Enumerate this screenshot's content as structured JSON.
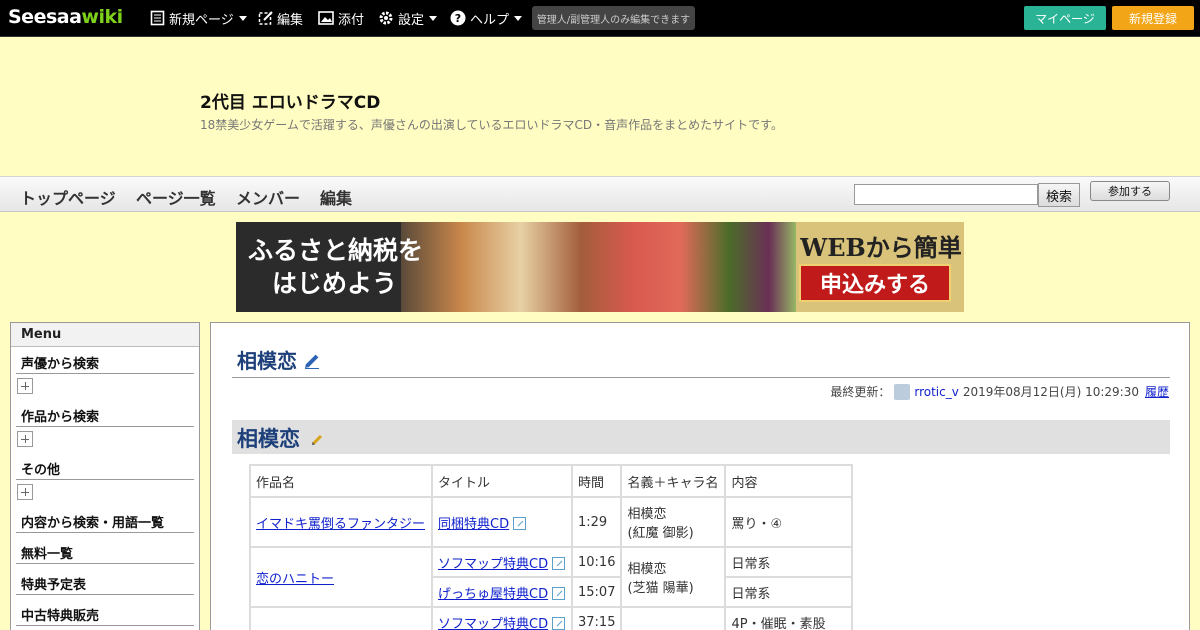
{
  "topbar": {
    "logo_part1": "Seesaa",
    "logo_part2": "wiki",
    "new_page": "新規ページ",
    "edit": "編集",
    "attach": "添付",
    "settings": "設定",
    "help": "ヘルプ",
    "note": "管理人/副管理人のみ編集できます",
    "mypage": "マイページ",
    "signup": "新規登録"
  },
  "header": {
    "title": "2代目 エロいドラマCD",
    "description": "18禁美少女ゲームで活躍する、声優さんの出演しているエロいドラマCD・音声作品をまとめたサイトです。"
  },
  "nav": {
    "top": "トップページ",
    "page_list": "ページ一覧",
    "members": "メンバー",
    "edit": "編集",
    "search_button": "検索",
    "join_button": "参加する"
  },
  "banner": {
    "line1": "ふるさと納税を",
    "line2": "はじめよう",
    "web": "WEBから簡単",
    "apply": "申込みする"
  },
  "sidebar": {
    "menu": "Menu",
    "items": [
      "声優から検索",
      "作品から検索",
      "その他",
      "内容から検索・用語一覧",
      "無料一覧",
      "特典予定表",
      "中古特典販売"
    ]
  },
  "main": {
    "page_title": "相模恋",
    "updated_label": "最終更新：",
    "user": "rrotic_v",
    "updated_date": "2019年08月12日(月) 10:29:30",
    "history": "履歴",
    "section_title": "相模恋"
  },
  "table": {
    "headers": [
      "作品名",
      "タイトル",
      "時間",
      "名義＋キャラ名",
      "内容"
    ],
    "r1": {
      "work": "イマドキ罵倒るファンタジー",
      "title": "同梱特典CD",
      "time": "1:29",
      "name1": "相模恋",
      "name2": "(紅魔 御影)",
      "content": "罵り・④"
    },
    "r2": {
      "work": "恋のハニトー",
      "title": "ソフマップ特典CD",
      "time": "10:16",
      "name1": "相模恋",
      "name2": "(芝猫 陽華)",
      "content": "日常系"
    },
    "r3": {
      "title": "げっちゅ屋特典CD",
      "time": "15:07",
      "content": "日常系"
    },
    "r4": {
      "title": "ソフマップ特典CD",
      "time": "37:15",
      "content": "4P・催眠・素股"
    }
  },
  "colors": {
    "header_bg": "#fffdc1",
    "title_blue": "#1d3f7a",
    "link_blue": "#1122cc",
    "mypage_btn": "#2ab394",
    "signup_btn": "#f2a516",
    "pink_text": "#e0208a"
  }
}
